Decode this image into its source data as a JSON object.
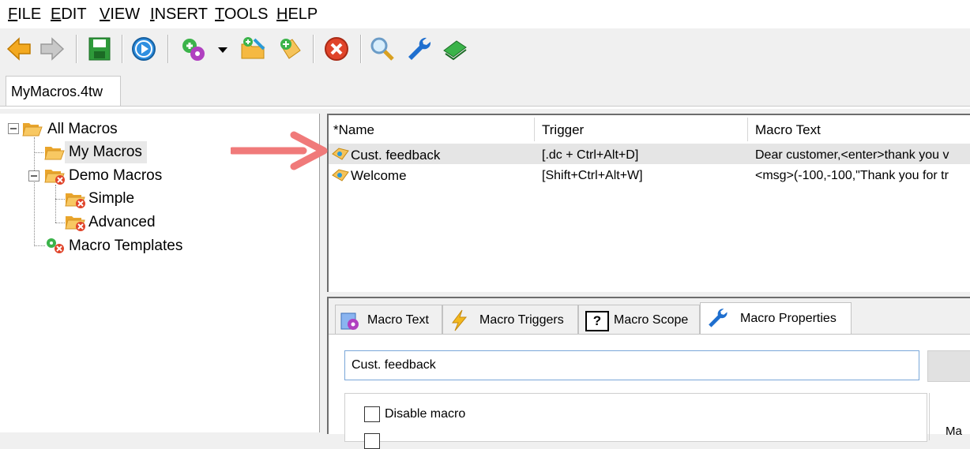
{
  "menu": {
    "items": [
      {
        "first": "F",
        "rest": "ILE"
      },
      {
        "first": "E",
        "rest": "DIT"
      },
      {
        "first": "V",
        "rest": "IEW"
      },
      {
        "first": "I",
        "rest": "NSERT"
      },
      {
        "first": "T",
        "rest": "OOLS"
      },
      {
        "first": "H",
        "rest": "ELP"
      }
    ]
  },
  "toolbar": {
    "icons": [
      "back-arrow-icon",
      "forward-arrow-icon",
      "save-icon",
      "play-icon",
      "new-macro-icon",
      "dropdown-icon",
      "add-folder-icon",
      "add-item-icon",
      "stop-icon",
      "search-icon",
      "wrench-icon",
      "book-icon"
    ]
  },
  "file_tab": {
    "label": "MyMacros.4tw"
  },
  "tree": {
    "root": "All Macros",
    "my_macros": "My Macros",
    "demo": "Demo Macros",
    "simple": "Simple",
    "advanced": "Advanced",
    "templates": "Macro Templates"
  },
  "list": {
    "headers": [
      "*Name",
      "Trigger",
      "Macro Text"
    ],
    "rows": [
      {
        "name": "Cust. feedback",
        "trigger": "[.dc + Ctrl+Alt+D]",
        "text": "Dear customer,<enter>thank you v"
      },
      {
        "name": "Welcome",
        "trigger": "[Shift+Ctrl+Alt+W]",
        "text": "<msg>(-100,-100,\"Thank you for tr"
      }
    ]
  },
  "panel_tabs": [
    "Macro Text",
    "Macro Triggers",
    "Macro Scope",
    "Macro Properties"
  ],
  "scope_icon_text": "?",
  "properties": {
    "name_value": "Cust. feedback",
    "disable_label": "Disable macro",
    "right_partial": "Ma"
  },
  "colors": {
    "arrow": "#f07a7a",
    "input_border": "#7aa7d8",
    "folder": "#f5b942"
  }
}
